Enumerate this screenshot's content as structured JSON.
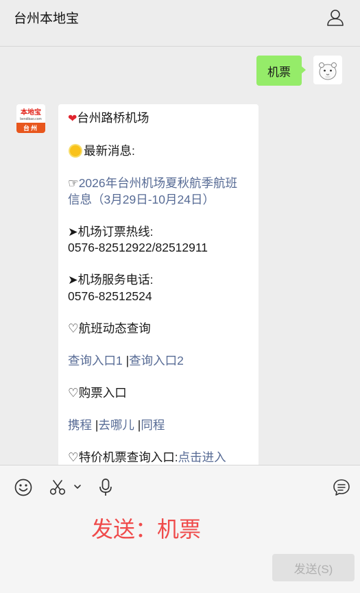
{
  "header": {
    "title": "台州本地宝"
  },
  "my_message": {
    "text": "机票"
  },
  "bot": {
    "avatar_logo": "本地宝",
    "avatar_site": "bendibao.com",
    "avatar_city": "台州",
    "title": "台州路桥机场",
    "news_label": "最新消息:",
    "pointer": "☞",
    "news_link_1": "2026年台州机场夏秋航季航班",
    "news_link_2": "信息（3月29日-10月24日）",
    "arrow": "➤",
    "ticket_hotline_label": "机场订票热线:",
    "ticket_hotline_number": "0576-82512922/82512911",
    "service_label": "机场服务电话:",
    "service_number": "0576-82512524",
    "heart": "♡",
    "flight_status_label": "航班动态查询",
    "query_link_1": "查询入口1",
    "separator": "|",
    "query_link_2": "查询入口2",
    "buy_label": "购票入口",
    "buy_links": [
      "携程",
      "去哪儿",
      "同程"
    ],
    "special_label": "特价机票查询入口:",
    "special_link": "点击进入"
  },
  "input": {
    "composed_text": "发送：机票"
  },
  "send_button": {
    "label": "发送(S)"
  }
}
